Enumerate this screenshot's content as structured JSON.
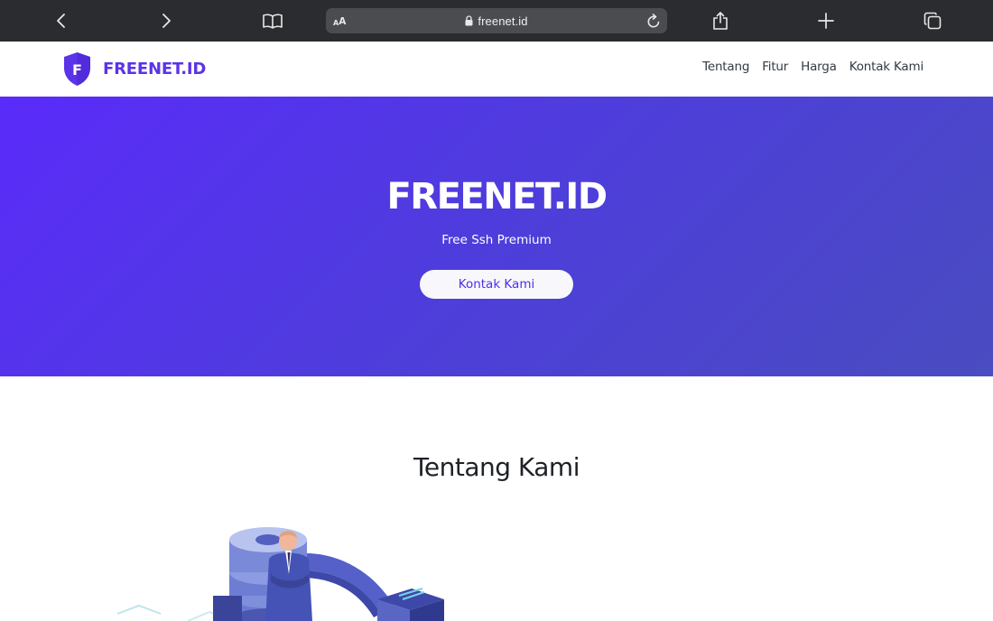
{
  "browser": {
    "url": "freenet.id",
    "text_size_small": "A",
    "text_size_big": "A"
  },
  "header": {
    "brand_letter": "F",
    "brand_name": "FREENET.ID",
    "nav": [
      "Tentang",
      "Fitur",
      "Harga",
      "Kontak Kami"
    ]
  },
  "hero": {
    "title": "FREENET.ID",
    "subtitle": "Free Ssh Premium",
    "cta": "Kontak Kami"
  },
  "about": {
    "title": "Tentang Kami"
  },
  "colors": {
    "brand": "#5b33e8",
    "hero_start": "#5a2bfa",
    "hero_end": "#4a4cc0",
    "toolbar": "#2a2c2f"
  },
  "icons": [
    "back-icon",
    "forward-icon",
    "bookmarks-icon",
    "lock-icon",
    "reload-icon",
    "share-icon",
    "new-tab-icon",
    "tabs-icon",
    "shield-logo-icon"
  ]
}
